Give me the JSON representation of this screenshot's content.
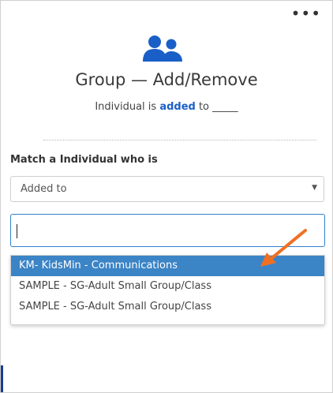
{
  "header": {
    "more_label": "•••",
    "icon": "users-group-icon",
    "title": "Group — Add/Remove",
    "subtitle_prefix": "Individual is ",
    "subtitle_keyword": "added",
    "subtitle_suffix": " to _____"
  },
  "form": {
    "match_label": "Match a Individual who is",
    "select_value": "Added to",
    "select_caret": "▼",
    "search_value": ""
  },
  "dropdown": {
    "options": [
      "KM- KidsMin - Communications",
      "SAMPLE - SG-Adult Small Group/Class",
      "SAMPLE - SG-Adult Small Group/Class"
    ],
    "highlighted_index": 0
  },
  "annotation": {
    "icon": "orange-arrow-icon"
  },
  "colors": {
    "accent_blue": "#1a5fc7",
    "highlight_blue": "#3b84c6",
    "input_focus_border": "#2f7fd0",
    "arrow_orange": "#f07022"
  }
}
